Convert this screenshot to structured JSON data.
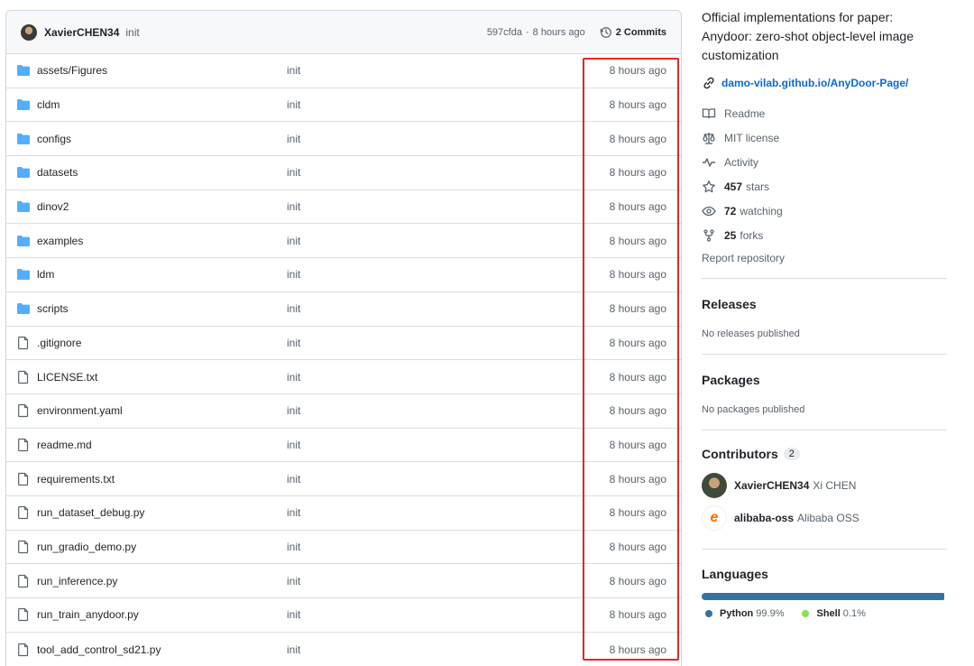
{
  "commit_header": {
    "author": "XavierCHEN34",
    "message": "init",
    "hash": "597cfda",
    "separator": "·",
    "time": "8 hours ago",
    "commits_label": "2 Commits"
  },
  "files": [
    {
      "name": "assets/Figures",
      "type": "folder",
      "message": "init",
      "time": "8 hours ago"
    },
    {
      "name": "cldm",
      "type": "folder",
      "message": "init",
      "time": "8 hours ago"
    },
    {
      "name": "configs",
      "type": "folder",
      "message": "init",
      "time": "8 hours ago"
    },
    {
      "name": "datasets",
      "type": "folder",
      "message": "init",
      "time": "8 hours ago"
    },
    {
      "name": "dinov2",
      "type": "folder",
      "message": "init",
      "time": "8 hours ago"
    },
    {
      "name": "examples",
      "type": "folder",
      "message": "init",
      "time": "8 hours ago"
    },
    {
      "name": "ldm",
      "type": "folder",
      "message": "init",
      "time": "8 hours ago"
    },
    {
      "name": "scripts",
      "type": "folder",
      "message": "init",
      "time": "8 hours ago"
    },
    {
      "name": ".gitignore",
      "type": "file",
      "message": "init",
      "time": "8 hours ago"
    },
    {
      "name": "LICENSE.txt",
      "type": "file",
      "message": "init",
      "time": "8 hours ago"
    },
    {
      "name": "environment.yaml",
      "type": "file",
      "message": "init",
      "time": "8 hours ago"
    },
    {
      "name": "readme.md",
      "type": "file",
      "message": "init",
      "time": "8 hours ago"
    },
    {
      "name": "requirements.txt",
      "type": "file",
      "message": "init",
      "time": "8 hours ago"
    },
    {
      "name": "run_dataset_debug.py",
      "type": "file",
      "message": "init",
      "time": "8 hours ago"
    },
    {
      "name": "run_gradio_demo.py",
      "type": "file",
      "message": "init",
      "time": "8 hours ago"
    },
    {
      "name": "run_inference.py",
      "type": "file",
      "message": "init",
      "time": "8 hours ago"
    },
    {
      "name": "run_train_anydoor.py",
      "type": "file",
      "message": "init",
      "time": "8 hours ago"
    },
    {
      "name": "tool_add_control_sd21.py",
      "type": "file",
      "message": "init",
      "time": "8 hours ago"
    }
  ],
  "about": {
    "description": "Official implementations for paper: Anydoor: zero-shot object-level image customization",
    "homepage": "damo-vilab.github.io/AnyDoor-Page/",
    "readme": "Readme",
    "license": "MIT license",
    "activity": "Activity",
    "stars_count": "457",
    "stars_label": "stars",
    "watching_count": "72",
    "watching_label": "watching",
    "forks_count": "25",
    "forks_label": "forks",
    "report": "Report repository"
  },
  "releases": {
    "title": "Releases",
    "note": "No releases published"
  },
  "packages": {
    "title": "Packages",
    "note": "No packages published"
  },
  "contributors": {
    "title": "Contributors",
    "count": "2",
    "items": [
      {
        "login": "XavierCHEN34",
        "name": "Xi CHEN"
      },
      {
        "login": "alibaba-oss",
        "name": "Alibaba OSS"
      }
    ]
  },
  "languages": {
    "title": "Languages",
    "items": [
      {
        "name": "Python",
        "percent": "99.9%",
        "share": 99.9,
        "color": "#3572A5"
      },
      {
        "name": "Shell",
        "percent": "0.1%",
        "share": 0.1,
        "color": "#89e051"
      }
    ]
  },
  "colors": {
    "accent": "#0969da",
    "highlight_box": "#e4262a",
    "folder": "#54aeff"
  }
}
